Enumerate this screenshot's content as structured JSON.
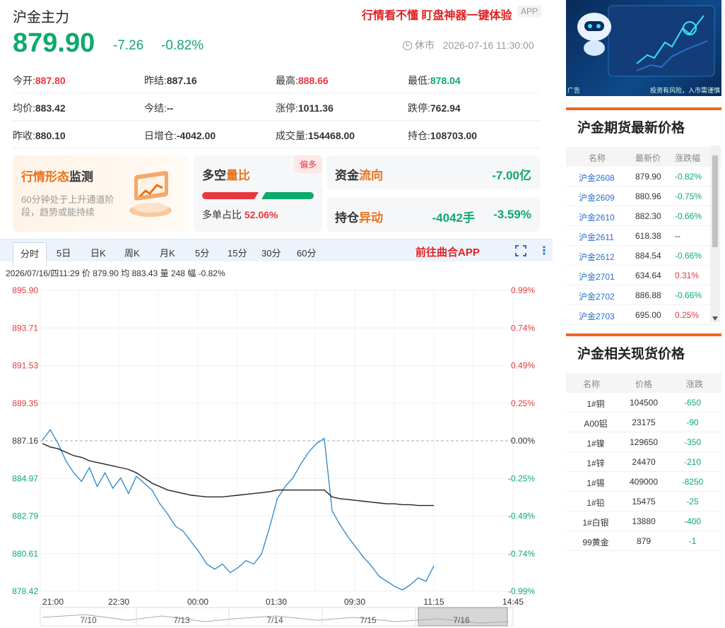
{
  "header": {
    "title": "沪金主力",
    "promo": "行情看不懂 盯盘神器一键体验",
    "app_badge": "APP",
    "price": "879.90",
    "change": "-7.26",
    "change_pct": "-0.82%",
    "status": "休市",
    "timestamp": "2026-07-16 11:30:00"
  },
  "stats": [
    [
      {
        "label": "今开:",
        "value": "887.80",
        "color": "red"
      },
      {
        "label": "昨结:",
        "value": "887.16",
        "color": ""
      },
      {
        "label": "最高:",
        "value": "888.66",
        "color": "red"
      },
      {
        "label": "最低:",
        "value": "878.04",
        "color": "green"
      }
    ],
    [
      {
        "label": "均价:",
        "value": "883.42",
        "color": ""
      },
      {
        "label": "今结:",
        "value": "--",
        "color": ""
      },
      {
        "label": "涨停:",
        "value": "1011.36",
        "color": ""
      },
      {
        "label": "跌停:",
        "value": "762.94",
        "color": ""
      }
    ],
    [
      {
        "label": "昨收:",
        "value": "880.10",
        "color": ""
      },
      {
        "label": "日增仓:",
        "value": "-4042.00",
        "color": ""
      },
      {
        "label": "成交量:",
        "value": "154468.00",
        "color": ""
      },
      {
        "label": "持仓:",
        "value": "108703.00",
        "color": ""
      }
    ]
  ],
  "cards": {
    "monitor_title_a": "行情形态",
    "monitor_title_b": "监测",
    "monitor_desc": "60分钟处于上升通道阶段，趋势或能持续",
    "longshort_title_a": "多空",
    "longshort_title_b": "量比",
    "longshort_tag": "偏多",
    "longshort_label": "多单占比",
    "longshort_value": "52.06%",
    "longshort_ratio": 0.5206,
    "flow_title_a": "资金",
    "flow_title_b": "流向",
    "flow_value": "-7.00亿",
    "pos_title_a": "持仓",
    "pos_title_b": "异动",
    "pos_value": "-4042手",
    "pos_pct": "-3.59%"
  },
  "tabs": [
    "分时",
    "5日",
    "日K",
    "周K",
    "月K",
    "5分",
    "15分",
    "30分",
    "60分"
  ],
  "active_tab": "分时",
  "go_app": "前往曲合APP",
  "info_line": "2026/07/16/四11:29  价 879.90  均 883.43  量 248  幅 -0.82%",
  "chart_data": {
    "type": "line",
    "y_left_ticks": [
      "895.90",
      "893.71",
      "891.53",
      "889.35",
      "887.16",
      "884.97",
      "882.79",
      "880.61",
      "878.42"
    ],
    "y_right_ticks": [
      "0.99%",
      "0.74%",
      "0.49%",
      "0.25%",
      "0.00%",
      "-0.25%",
      "-0.49%",
      "-0.74%",
      "-0.99%"
    ],
    "x_ticks": [
      "21:00",
      "22:30",
      "00:00",
      "01:30",
      "09:30",
      "11:15",
      "14:45"
    ],
    "ylim": [
      878.42,
      895.9
    ],
    "reference": 887.16,
    "series": [
      {
        "values": [
          887.2,
          887.8,
          887.0,
          886.0,
          885.3,
          884.8,
          885.6,
          884.5,
          885.3,
          884.4,
          885.0,
          884.1,
          885.1,
          884.7,
          884.3,
          883.5,
          882.9,
          882.2,
          881.9,
          881.3,
          880.7,
          880.0,
          879.7,
          880.0,
          879.5,
          879.8,
          880.2,
          880.0,
          880.6,
          882.1,
          883.8,
          884.5,
          885.0,
          885.8,
          886.5,
          887.0,
          887.3,
          883.1,
          882.3,
          881.6,
          881.0,
          880.4,
          879.9,
          879.3,
          879.0,
          878.7,
          878.5,
          878.8,
          879.2,
          879.0,
          879.9
        ]
      },
      {
        "values": [
          887.0,
          886.8,
          886.7,
          886.5,
          886.3,
          886.2,
          886.0,
          885.9,
          885.8,
          885.7,
          885.6,
          885.5,
          885.3,
          885.0,
          884.7,
          884.5,
          884.3,
          884.2,
          884.1,
          884.0,
          883.95,
          883.9,
          883.9,
          883.9,
          883.95,
          884.0,
          884.05,
          884.1,
          884.15,
          884.2,
          884.3,
          884.3,
          884.3,
          884.3,
          884.3,
          884.3,
          884.3,
          883.9,
          883.8,
          883.75,
          883.7,
          883.65,
          883.6,
          883.55,
          883.5,
          883.5,
          883.45,
          883.45,
          883.4,
          883.4,
          883.4
        ]
      }
    ]
  },
  "navigator_labels": [
    "7/10",
    "7/13",
    "7/14",
    "7/15",
    "7/16"
  ],
  "ad": {
    "label_left": "广告",
    "label_right": "投资有风险，入市需谨慎"
  },
  "futures_panel": {
    "title": "沪金期货最新价格",
    "headers": [
      "名称",
      "最新价",
      "涨跌幅"
    ],
    "rows": [
      {
        "name": "沪金2608",
        "price": "879.90",
        "pct": "-0.82%",
        "color": "green"
      },
      {
        "name": "沪金2609",
        "price": "880.96",
        "pct": "-0.75%",
        "color": "green"
      },
      {
        "name": "沪金2610",
        "price": "882.30",
        "pct": "-0.66%",
        "color": "green"
      },
      {
        "name": "沪金2611",
        "price": "618.38",
        "pct": "--",
        "color": ""
      },
      {
        "name": "沪金2612",
        "price": "884.54",
        "pct": "-0.66%",
        "color": "green"
      },
      {
        "name": "沪金2701",
        "price": "634.64",
        "pct": "0.31%",
        "color": "red"
      },
      {
        "name": "沪金2702",
        "price": "886.88",
        "pct": "-0.66%",
        "color": "green"
      },
      {
        "name": "沪金2703",
        "price": "695.00",
        "pct": "0.25%",
        "color": "red"
      }
    ]
  },
  "spot_panel": {
    "title": "沪金相关现货价格",
    "headers": [
      "名称",
      "价格",
      "涨跌"
    ],
    "rows": [
      {
        "name": "1#铜",
        "price": "104500",
        "chg": "-650"
      },
      {
        "name": "A00铝",
        "price": "23175",
        "chg": "-90"
      },
      {
        "name": "1#镍",
        "price": "129650",
        "chg": "-350"
      },
      {
        "name": "1#锌",
        "price": "24470",
        "chg": "-210"
      },
      {
        "name": "1#锡",
        "price": "409000",
        "chg": "-8250"
      },
      {
        "name": "1#铅",
        "price": "15475",
        "chg": "-25"
      },
      {
        "name": "1#白银",
        "price": "13880",
        "chg": "-400"
      },
      {
        "name": "99黄金",
        "price": "879",
        "chg": "-1"
      }
    ]
  }
}
